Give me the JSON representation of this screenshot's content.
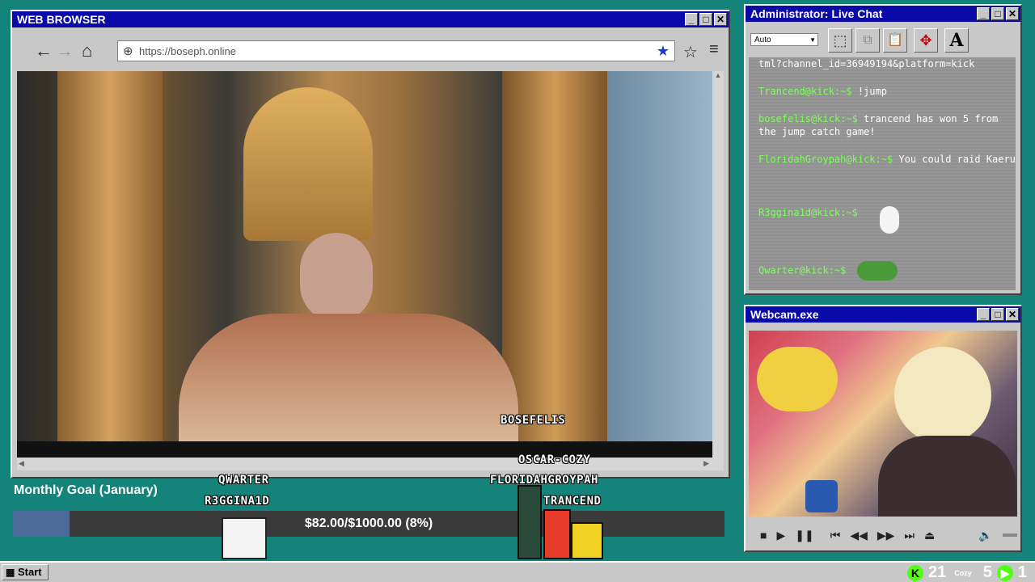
{
  "browser": {
    "title": "WEB BROWSER",
    "url": "https://boseph.online",
    "video_caption": "BOSEFELIS"
  },
  "chat": {
    "title": "Administrator: Live Chat",
    "font_select": "Auto",
    "messages": [
      {
        "user": "",
        "text": "tml?channel_id=36949194&platform=kick"
      },
      {
        "user": "Trancend@kick:~$",
        "text": "!jump"
      },
      {
        "user": "bosefelis@kick:~$",
        "text": "trancend has won 5 from the jump catch game!"
      },
      {
        "user": "FloridahGroypah@kick:~$",
        "text": "You could raid Kaeru"
      },
      {
        "user": "R3ggina1d@kick:~$",
        "text": ""
      },
      {
        "user": "Qwarter@kick:~$",
        "text": ""
      }
    ]
  },
  "webcam": {
    "title": "Webcam.exe"
  },
  "goal": {
    "title": "Monthly Goal (January)",
    "text": "$82.00/$1000.00 (8%)",
    "fraction": 0.08
  },
  "sprites": {
    "qwarter": "QWARTER",
    "r3ggina1d": "R3GGINA1D",
    "oscar": "OSCAR-COZY",
    "floridah": "FLORIDAHGROYPAH",
    "trancend": "TRANCEND"
  },
  "taskbar": {
    "start": "Start",
    "kick_count": "21",
    "cozy_label": "Cozy",
    "other_count": "5",
    "play_count": "1"
  },
  "colors": {
    "desktop": "#14847a",
    "titlebar": "#0a0aa8",
    "chat_user": "#7cff5a",
    "goal_fill": "#4a6a9a"
  }
}
